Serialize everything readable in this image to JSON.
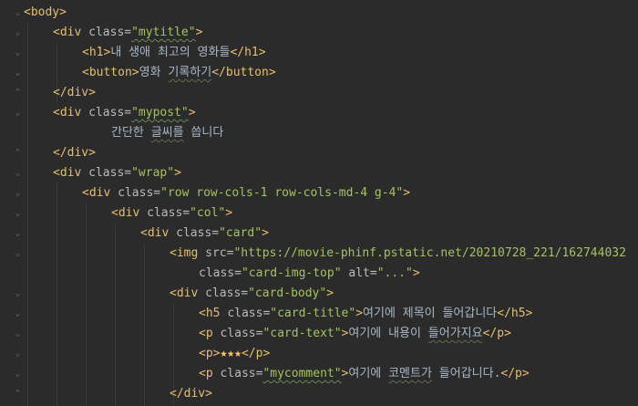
{
  "editor": {
    "lines": [
      {
        "id": "l1",
        "indent": 0,
        "parts": [
          {
            "t": "tag",
            "s": "<body>"
          }
        ]
      },
      {
        "id": "l2",
        "indent": 1,
        "parts": [
          {
            "t": "tag",
            "s": "<div "
          },
          {
            "t": "attr",
            "s": "class="
          },
          {
            "t": "val",
            "s": "\"mytitle\""
          },
          {
            "t": "tag",
            "s": ">"
          }
        ]
      },
      {
        "id": "l3",
        "indent": 2,
        "parts": [
          {
            "t": "tag",
            "s": "<h1>"
          },
          {
            "t": "txt",
            "s": "내 생애 최고의 영화들"
          },
          {
            "t": "tag",
            "s": "</h1>"
          }
        ]
      },
      {
        "id": "l4",
        "indent": 2,
        "parts": [
          {
            "t": "tag",
            "s": "<button>"
          },
          {
            "t": "txt",
            "s": "영화 기록하기"
          },
          {
            "t": "tag",
            "s": "</button>"
          }
        ]
      },
      {
        "id": "l5",
        "indent": 1,
        "parts": [
          {
            "t": "tag",
            "s": "</div>"
          }
        ]
      },
      {
        "id": "l6",
        "indent": 1,
        "parts": [
          {
            "t": "tag",
            "s": "<div "
          },
          {
            "t": "attr",
            "s": "class="
          },
          {
            "t": "val",
            "s": "\"mypost\""
          },
          {
            "t": "tag",
            "s": ">"
          }
        ]
      },
      {
        "id": "l7",
        "indent": 3,
        "parts": [
          {
            "t": "txt",
            "s": "간단한 글씨를 씁니다"
          }
        ]
      },
      {
        "id": "l8",
        "indent": 1,
        "parts": [
          {
            "t": "tag",
            "s": "</div>"
          }
        ]
      },
      {
        "id": "l9",
        "indent": 1,
        "parts": [
          {
            "t": "tag",
            "s": "<div "
          },
          {
            "t": "attr",
            "s": "class="
          },
          {
            "t": "val",
            "s": "\"wrap\""
          },
          {
            "t": "tag",
            "s": ">"
          }
        ]
      },
      {
        "id": "l10",
        "indent": 2,
        "parts": [
          {
            "t": "tag",
            "s": "<div "
          },
          {
            "t": "attr",
            "s": "class="
          },
          {
            "t": "val",
            "s": "\"row row-cols-1 row-cols-md-4 g-4\""
          },
          {
            "t": "tag",
            "s": ">"
          }
        ]
      },
      {
        "id": "l11",
        "indent": 3,
        "parts": [
          {
            "t": "tag",
            "s": "<div "
          },
          {
            "t": "attr",
            "s": "class="
          },
          {
            "t": "val",
            "s": "\"col\""
          },
          {
            "t": "tag",
            "s": ">"
          }
        ]
      },
      {
        "id": "l12",
        "indent": 4,
        "parts": [
          {
            "t": "tag",
            "s": "<div "
          },
          {
            "t": "attr",
            "s": "class="
          },
          {
            "t": "val",
            "s": "\"card\""
          },
          {
            "t": "tag",
            "s": ">"
          }
        ]
      },
      {
        "id": "l13",
        "indent": 5,
        "parts": [
          {
            "t": "tag",
            "s": "<img "
          },
          {
            "t": "attr",
            "s": "src="
          },
          {
            "t": "val",
            "s": "\"https://movie-phinf.pstatic.net/20210728_221/162744032"
          }
        ]
      },
      {
        "id": "l14",
        "indent": 6,
        "parts": [
          {
            "t": "attr",
            "s": "class="
          },
          {
            "t": "val",
            "s": "\"card-img-top\" "
          },
          {
            "t": "attr",
            "s": "alt="
          },
          {
            "t": "val",
            "s": "\"...\""
          },
          {
            "t": "tag",
            "s": ">"
          }
        ]
      },
      {
        "id": "l15",
        "indent": 5,
        "parts": [
          {
            "t": "tag",
            "s": "<div "
          },
          {
            "t": "attr",
            "s": "class="
          },
          {
            "t": "val",
            "s": "\"card-body\""
          },
          {
            "t": "tag",
            "s": ">"
          }
        ]
      },
      {
        "id": "l16",
        "indent": 6,
        "parts": [
          {
            "t": "tag",
            "s": "<h5 "
          },
          {
            "t": "attr",
            "s": "class="
          },
          {
            "t": "val",
            "s": "\"card-title\""
          },
          {
            "t": "tag",
            "s": ">"
          },
          {
            "t": "txt",
            "s": "여기에 제목이 들어갑니다"
          },
          {
            "t": "tag",
            "s": "</h5>"
          }
        ]
      },
      {
        "id": "l17",
        "indent": 6,
        "parts": [
          {
            "t": "tag",
            "s": "<p "
          },
          {
            "t": "attr",
            "s": "class="
          },
          {
            "t": "val",
            "s": "\"card-text\""
          },
          {
            "t": "tag",
            "s": ">"
          },
          {
            "t": "txt",
            "s": "여기에 내용이 들어가지요"
          },
          {
            "t": "tag",
            "s": "</p>"
          }
        ]
      },
      {
        "id": "l18",
        "indent": 6,
        "parts": [
          {
            "t": "tag",
            "s": "<p>"
          },
          {
            "t": "star",
            "s": "★★★"
          },
          {
            "t": "tag",
            "s": "</p>"
          }
        ]
      },
      {
        "id": "l19",
        "indent": 6,
        "parts": [
          {
            "t": "tag",
            "s": "<p "
          },
          {
            "t": "attr",
            "s": "class="
          },
          {
            "t": "val",
            "s": "\"mycomment\""
          },
          {
            "t": "tag",
            "s": ">"
          },
          {
            "t": "txt",
            "s": "여기에 코멘트가 들어갑니다."
          },
          {
            "t": "tag",
            "s": "</p>"
          }
        ]
      },
      {
        "id": "l20",
        "indent": 5,
        "parts": [
          {
            "t": "tag",
            "s": "</div>"
          }
        ]
      }
    ]
  },
  "colors": {
    "background": "#2b2b2b",
    "tag": "#e8bf6a",
    "attribute": "#bababa",
    "value": "#a5c261",
    "text": "#a9b7c6"
  }
}
